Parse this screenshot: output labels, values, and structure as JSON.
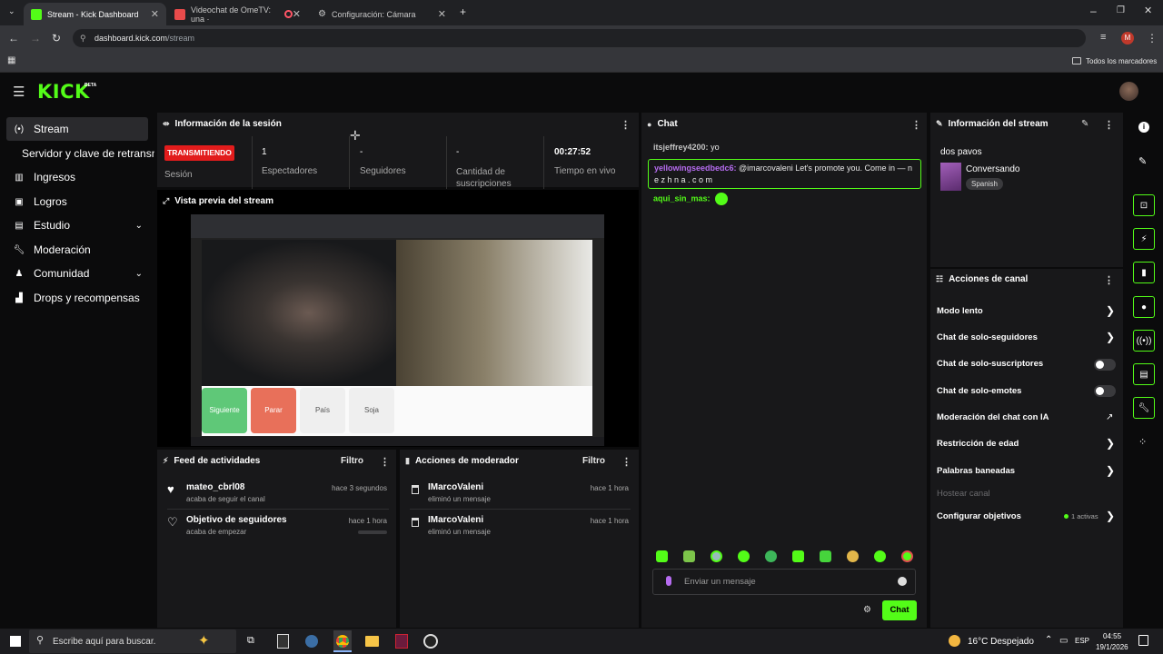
{
  "browser": {
    "tabs": [
      {
        "title": "Stream - Kick Dashboard"
      },
      {
        "title": "Videochat de OmeTV: una ·"
      },
      {
        "title": "Configuración: Cámara"
      }
    ],
    "url_host": "dashboard.kick.com",
    "url_path": "/stream",
    "bookmarks_label": "Todos los marcadores",
    "profile_initial": "M"
  },
  "brand": {
    "logo": "KICK",
    "badge": "BETA",
    "accent": "#53fc18"
  },
  "sidebar": {
    "items": [
      {
        "label": "Stream",
        "icon": "broadcast-icon"
      },
      {
        "label": "Servidor y clave de retransmi",
        "icon": ""
      },
      {
        "label": "Ingresos",
        "icon": "bank-icon"
      },
      {
        "label": "Logros",
        "icon": "trophy-icon"
      },
      {
        "label": "Estudio",
        "icon": "studio-icon"
      },
      {
        "label": "Moderación",
        "icon": "wrench-icon"
      },
      {
        "label": "Comunidad",
        "icon": "people-icon"
      },
      {
        "label": "Drops y recompensas",
        "icon": "gift-icon"
      }
    ]
  },
  "session": {
    "title": "Información de la sesión",
    "status_badge": "TRANSMITIENDO",
    "status_label": "Sesión",
    "stats": [
      {
        "value": "1",
        "label": "Espectadores"
      },
      {
        "value": "-",
        "label": "Seguidores"
      },
      {
        "value": "-",
        "label": "Cantidad de suscripciones"
      },
      {
        "value": "00:27:52",
        "label": "Tiempo en vivo"
      }
    ]
  },
  "preview": {
    "title": "Vista previa del stream",
    "buttons": [
      "Siguiente",
      "Parar",
      "País",
      "Soja"
    ]
  },
  "activity": {
    "title": "Feed de actividades",
    "filter": "Filtro",
    "items": [
      {
        "name": "mateo_cbrl08",
        "desc": "acaba de seguir el canal",
        "time": "hace 3 segundos"
      },
      {
        "name": "Objetivo de seguidores",
        "desc": "acaba de empezar",
        "time": "hace 1 hora"
      }
    ]
  },
  "modactions": {
    "title": "Acciones de moderador",
    "filter": "Filtro",
    "items": [
      {
        "name": "IMarcoValeni",
        "desc": "eliminó un mensaje",
        "time": "hace 1 hora"
      },
      {
        "name": "IMarcoValeni",
        "desc": "eliminó un mensaje",
        "time": "hace 1 hora"
      }
    ]
  },
  "chat": {
    "title": "Chat",
    "messages": [
      {
        "user": "itsjeffrey4200:",
        "text": "yo",
        "color": "#c3c3c3"
      },
      {
        "user": "yellowingseedbedc6:",
        "text": "@imarcovaleni Let's promote you. Come in — n e z h n a . c o m",
        "color": "#b66cf0"
      },
      {
        "user": "aqui_sin_mas:",
        "text": "",
        "color": "#53fc18"
      }
    ],
    "input_placeholder": "Enviar un mensaje",
    "send_label": "Chat"
  },
  "stream_info": {
    "title": "Información del stream",
    "stream_title": "dos pavos",
    "category": "Conversando",
    "language": "Spanish"
  },
  "channel_actions": {
    "title": "Acciones de canal",
    "items": [
      {
        "label": "Modo lento",
        "control": "arrow"
      },
      {
        "label": "Chat de solo-seguidores",
        "control": "arrow"
      },
      {
        "label": "Chat de solo-suscriptores",
        "control": "toggle",
        "on": false
      },
      {
        "label": "Chat de solo-emotes",
        "control": "toggle",
        "on": false
      },
      {
        "label": "Moderación del chat con IA",
        "control": "external"
      },
      {
        "label": "Restricción de edad",
        "control": "arrow"
      },
      {
        "label": "Palabras baneadas",
        "control": "arrow"
      },
      {
        "label": "Hostear canal",
        "control": "none",
        "disabled": true
      },
      {
        "label": "Configurar objetivos",
        "control": "arrow",
        "extra": "1 activas"
      }
    ]
  },
  "taskbar": {
    "search_placeholder": "Escribe aquí para buscar.",
    "weather": "16°C  Despejado",
    "lang": "ESP",
    "time": "04:55",
    "date": "19/1/2026"
  }
}
